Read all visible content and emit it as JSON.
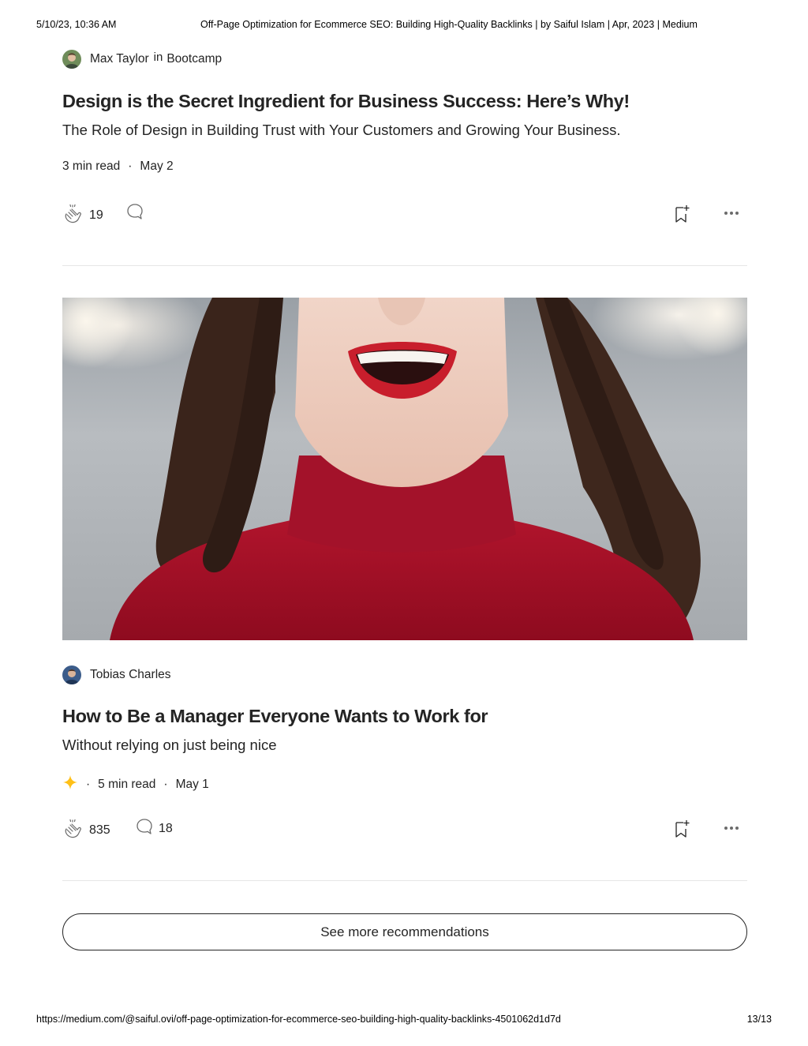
{
  "print": {
    "date": "5/10/23, 10:36 AM",
    "title": "Off-Page Optimization for Ecommerce SEO: Building High-Quality Backlinks | by Saiful Islam | Apr, 2023 | Medium",
    "url": "https://medium.com/@saiful.ovi/off-page-optimization-for-ecommerce-seo-building-high-quality-backlinks-4501062d1d7d",
    "page": "13/13"
  },
  "articles": [
    {
      "author": "Max Taylor",
      "in_word": "in",
      "publication": "Bootcamp",
      "title": "Design is the Secret Ingredient for Business Success: Here’s Why!",
      "subtitle": "The Role of Design in Building Trust with Your Customers and Growing Your Business.",
      "read_time": "3 min read",
      "dot": "·",
      "date": "May 2",
      "claps": "19",
      "responses": ""
    },
    {
      "author": "Tobias Charles",
      "title": "How to Be a Manager Everyone Wants to Work for",
      "subtitle": "Without relying on just being nice",
      "read_time": "5 min read",
      "dot": "·",
      "date": "May 1",
      "claps": "835",
      "responses": "18",
      "member_icon": "sparkle-icon"
    }
  ],
  "see_more": "See more recommendations",
  "colors": {
    "text": "#242424",
    "divider": "#e6e6e6",
    "star": "#ffc017"
  }
}
